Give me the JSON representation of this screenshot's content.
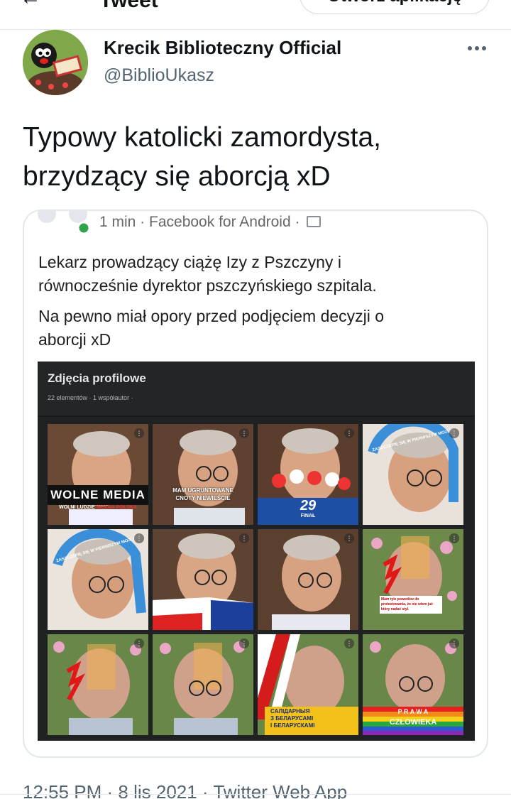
{
  "header": {
    "back_icon": "arrow-left-icon",
    "title": "Tweet",
    "open_app_label": "Otwórz aplikację"
  },
  "author": {
    "name": "Krecik Biblioteczny Official",
    "handle": "@BiblioUkasz"
  },
  "tweet": {
    "text_line1": "Typowy katolicki zamordysta,",
    "text_line2": "brzydzący się aborcją xD"
  },
  "embedded_post": {
    "meta": "1 min · Facebook for Android ·",
    "privacy_icon": "friends-icon",
    "paragraph1_line1": "Lekarz prowadzący ciążę Izy z Pszczyny i",
    "paragraph1_line2": "równocześnie dyrektor pszczyńskiego szpitala.",
    "paragraph2_line1": "Na pewno miał opory przed podjęciem decyzji o",
    "paragraph2_line2": "aborcji xD",
    "album": {
      "title": "Zdjęcia profilowe",
      "subtitle": "22 elementów · 1 współautor ·",
      "overlays": {
        "p1_main": "WOLNE MEDIA",
        "p1_sub": "WOLNI LUDZIE",
        "p1_sub2": "WOLNA POLSKA",
        "p2_line1": "MAM UGRUNTOWANE",
        "p2_line2": "CNOTY NIEWIEŚCIE",
        "p3_num": "29",
        "p3_sub": "FINAŁ",
        "p4_ring": "ZASZCZEPIĘ SIĘ W PIERWSZYM MOŻLIWYM TERMINIE",
        "p5_ring": "ZASZCZEPIĘ SIĘ W PIERWSZYM MOŻLIWYM TERMINIE",
        "p8_note": "Mam tyle powodów do protestowania, że nie wiem już który nadać styl.",
        "p11_line1": "САЛІДАРНЫЯ",
        "p11_line2": "З БЕЛАРУСАМІ",
        "p11_line3": "І БЕЛАРУСКАМІ",
        "p12_line1": "P R A W A",
        "p12_line2": "CZŁOWIEKA"
      }
    }
  },
  "tweet_meta": "12:55 PM · 8 lis 2021 · Twitter Web App",
  "colors": {
    "text": "#0f1419",
    "secondary": "#536471",
    "card_border": "#e1e8ed",
    "online": "#31a24c",
    "album_bg": "#202123"
  }
}
